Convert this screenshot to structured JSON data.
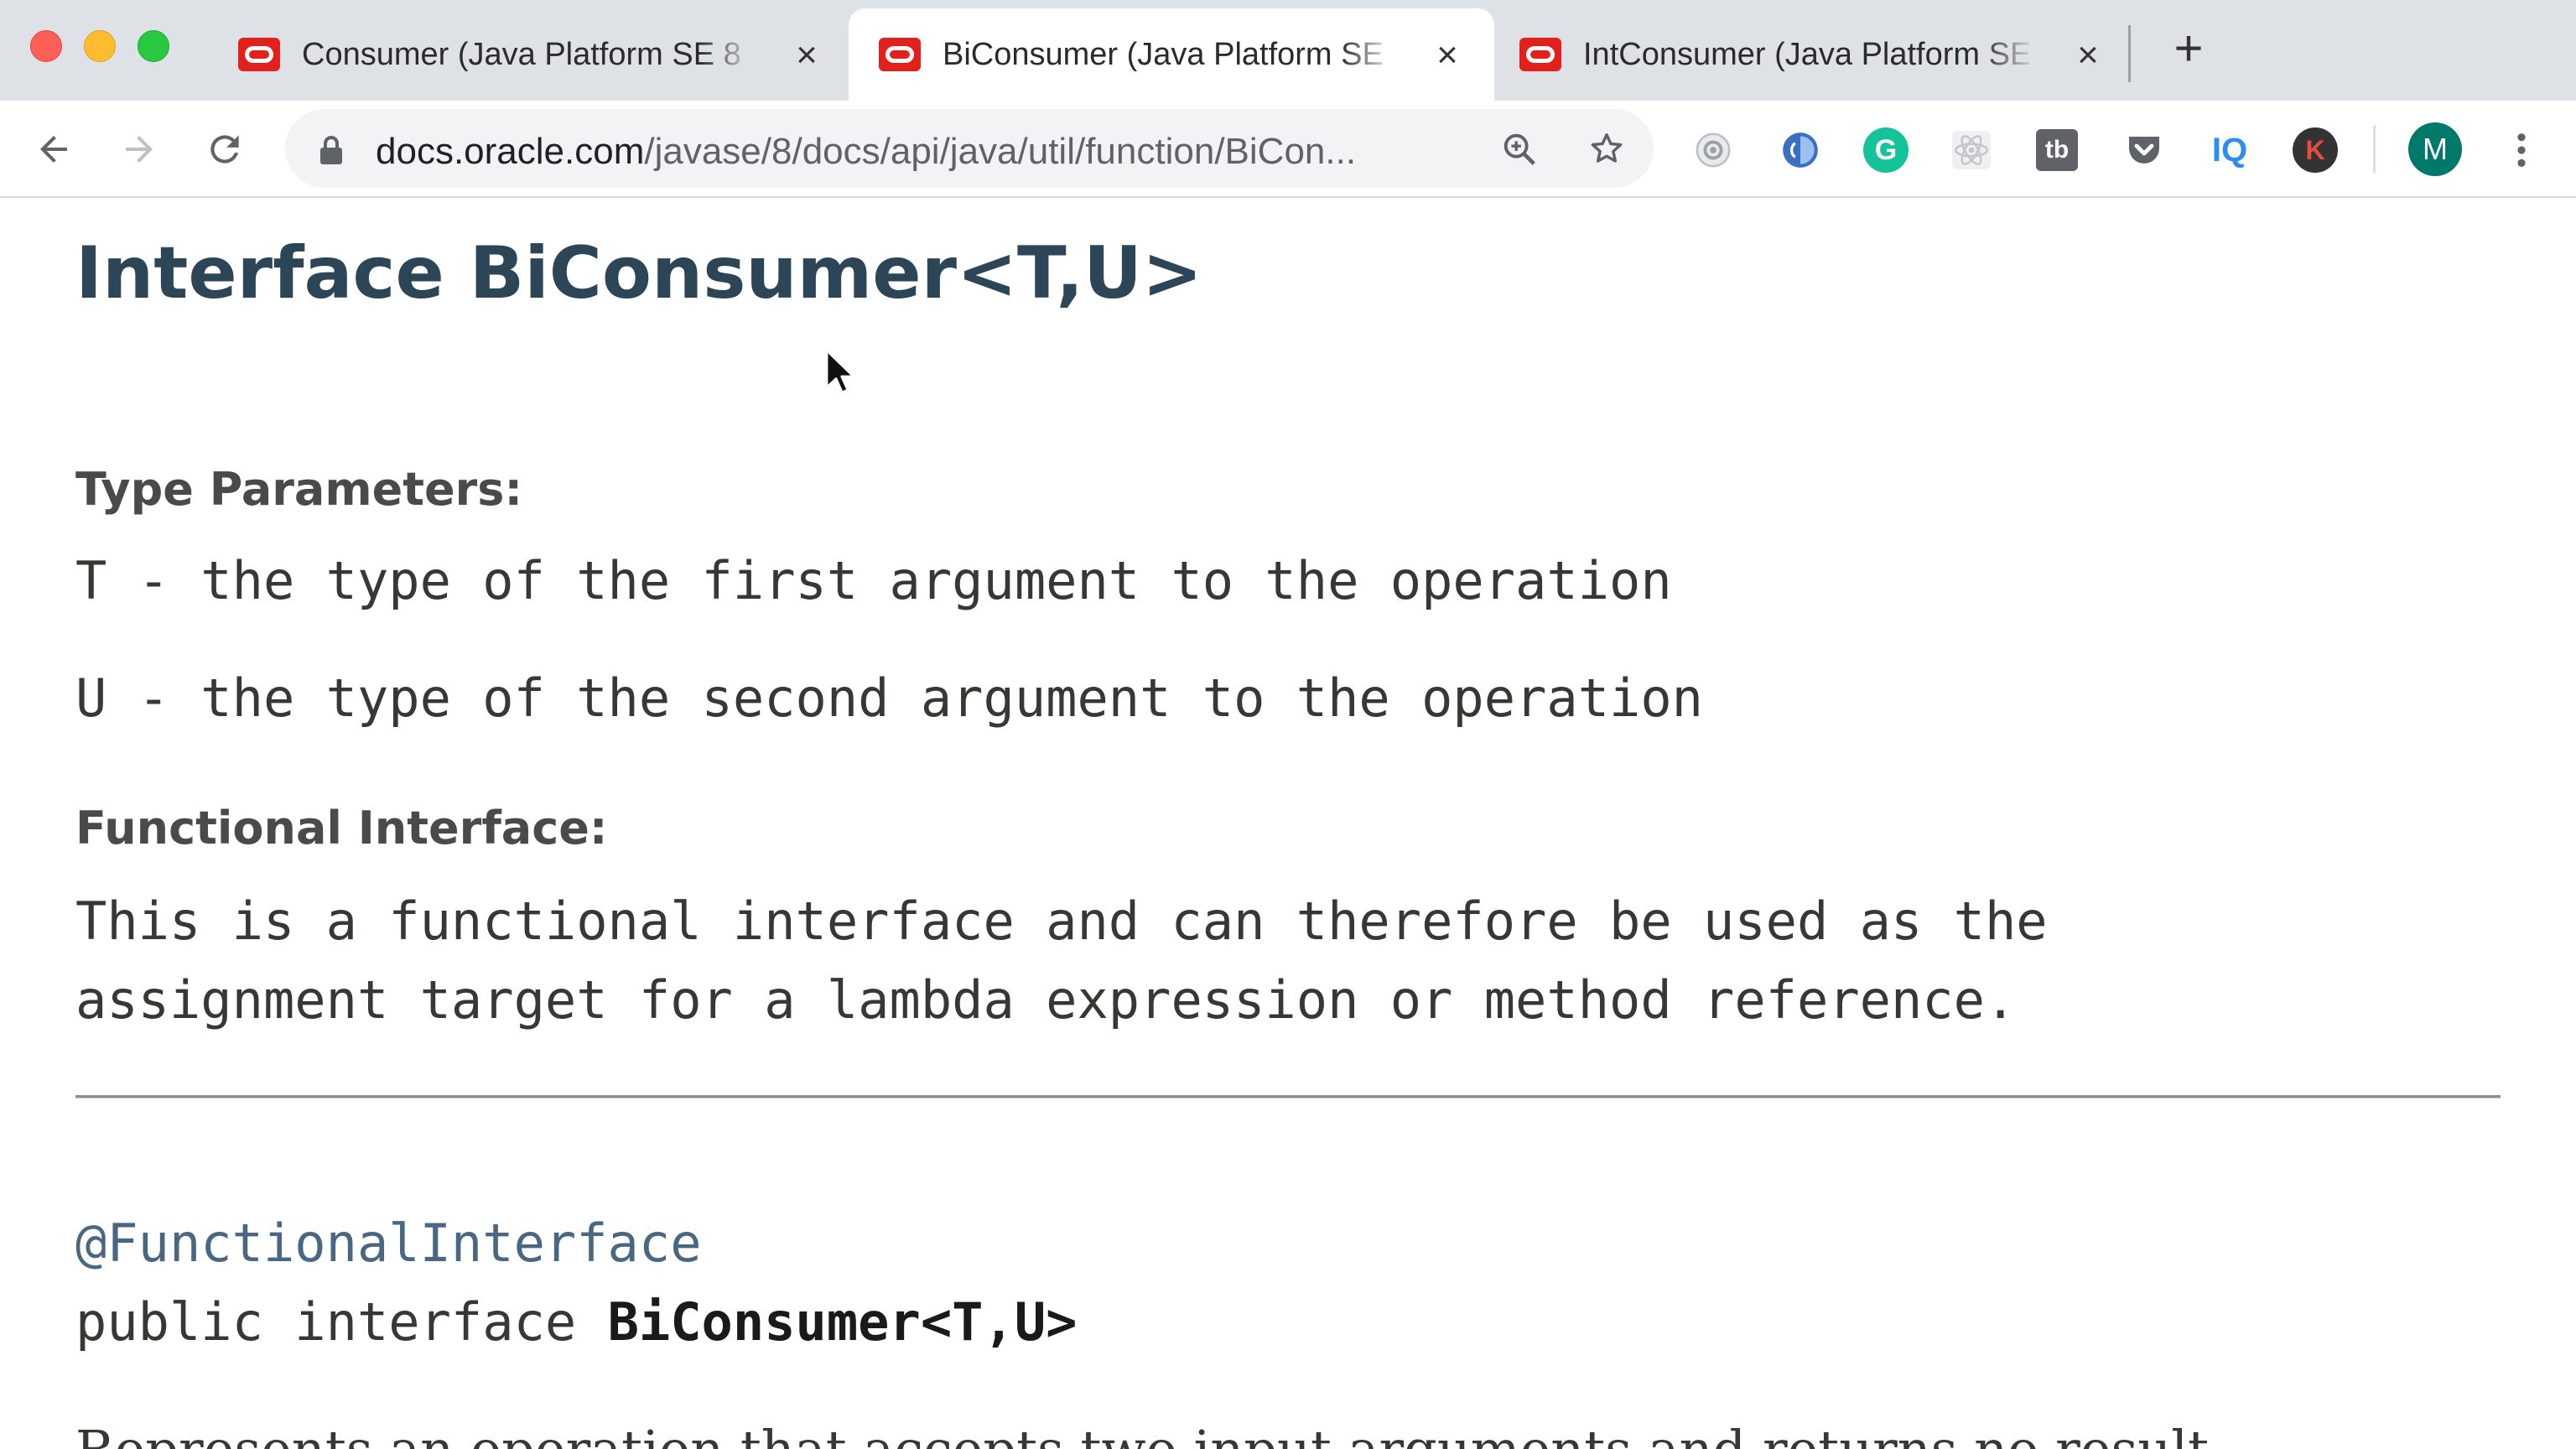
{
  "window": {
    "controls": [
      "close",
      "minimize",
      "zoom"
    ]
  },
  "tabs": [
    {
      "title": "Consumer (Java Platform SE 8",
      "active": false,
      "favicon": "oracle-icon"
    },
    {
      "title": "BiConsumer (Java Platform SE",
      "active": true,
      "favicon": "oracle-icon"
    },
    {
      "title": "IntConsumer (Java Platform SE",
      "active": false,
      "favicon": "oracle-icon"
    }
  ],
  "toolbar": {
    "url_host": "docs.oracle.com",
    "url_path": "/javase/8/docs/api/java/util/function/BiCon...",
    "extensions": [
      "camera-extension-icon",
      "shield-extension-icon",
      "grammarly-icon",
      "react-devtools-icon",
      "tab-extension-icon",
      "pocket-icon",
      "iq-extension-icon",
      "k-extension-icon"
    ],
    "iq_label": "IQ",
    "k_label": "K",
    "grammarly_label": "G",
    "tb_label": "tb",
    "profile_initial": "M"
  },
  "content": {
    "heading": "Interface BiConsumer<T,U>",
    "type_params_label": "Type Parameters:",
    "type_params": [
      "T - the type of the first argument to the operation",
      "U - the type of the second argument to the operation"
    ],
    "functional_label": "Functional Interface:",
    "functional_desc_line1": "This is a functional interface and can therefore be used as the",
    "functional_desc_line2": "assignment target for a lambda expression or method reference.",
    "annotation": "@FunctionalInterface",
    "signature_prefix": "public interface ",
    "signature_name": "BiConsumer<T,U>",
    "description_partial": "Represents an operation that accepts two input arguments and returns no result."
  },
  "colors": {
    "heading": "#2c4557",
    "annotation": "#4a6782",
    "tab_strip": "#dee1e6",
    "oracle_red": "#e2211c"
  }
}
